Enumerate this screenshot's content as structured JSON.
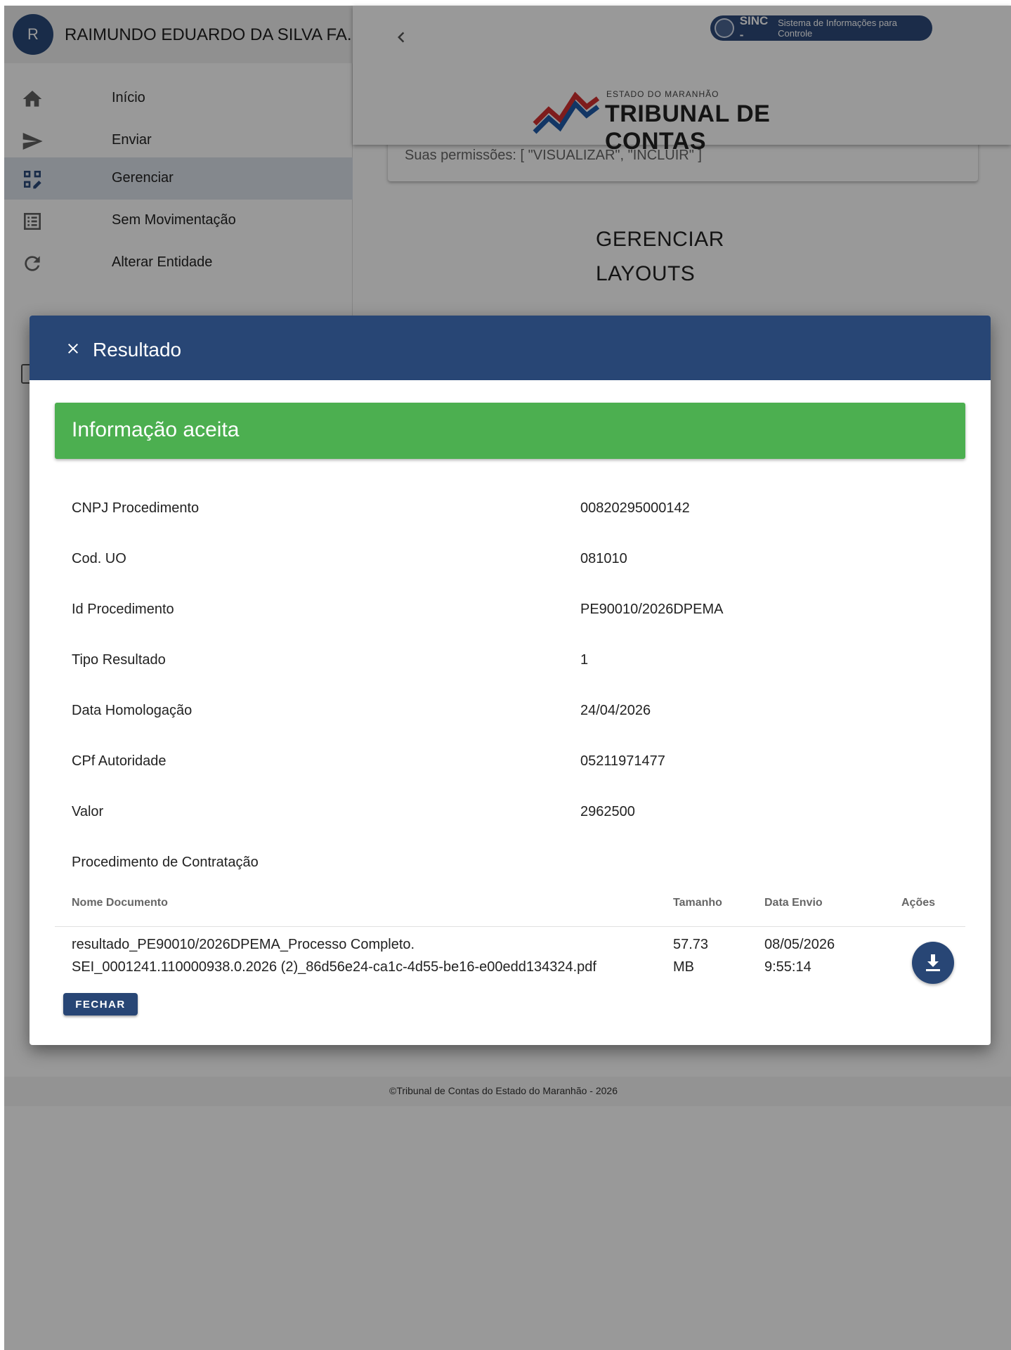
{
  "user": {
    "initial": "R",
    "name": "RAIMUNDO EDUARDO DA SILVA FA..."
  },
  "nav": [
    {
      "label": "Início",
      "icon": "home-icon"
    },
    {
      "label": "Enviar",
      "icon": "send-icon"
    },
    {
      "label": "Gerenciar",
      "icon": "manage-icon",
      "active": true
    },
    {
      "label": "Sem Movimentação",
      "icon": "list-icon"
    },
    {
      "label": "Alterar Entidade",
      "icon": "refresh-icon"
    }
  ],
  "header": {
    "sinc_name": "SINC -",
    "sinc_sub": "Sistema de Informações para Controle",
    "org_small": "ESTADO DO MARANHÃO",
    "org_big": "TRIBUNAL DE CONTAS"
  },
  "main": {
    "permissions": "Suas permissões: [ \"VISUALIZAR\", \"INCLUIR\" ]",
    "title_line1": "GERENCIAR",
    "title_line2": "LAYOUTS"
  },
  "footer": "©Tribunal de Contas do Estado do Maranhão - 2026",
  "dialog": {
    "title": "Resultado",
    "status": "Informação aceita",
    "fields": [
      {
        "label": "CNPJ Procedimento",
        "value": "00820295000142"
      },
      {
        "label": "Cod. UO",
        "value": "081010"
      },
      {
        "label": "Id Procedimento",
        "value": "PE90010/2026DPEMA"
      },
      {
        "label": "Tipo Resultado",
        "value": "1"
      },
      {
        "label": "Data Homologação",
        "value": "24/04/2026"
      },
      {
        "label": "CPf Autoridade",
        "value": "05211971477"
      },
      {
        "label": "Valor",
        "value": "2962500"
      },
      {
        "label": "Procedimento de Contratação",
        "value": ""
      }
    ],
    "table": {
      "headers": {
        "name": "Nome Documento",
        "size": "Tamanho",
        "date": "Data Envio",
        "actions": "Ações"
      },
      "rows": [
        {
          "name_line1": "resultado_PE90010/2026DPEMA_Processo Completo.",
          "name_line2": "SEI_0001241.110000938.0.2026 (2)_86d56e24-ca1c-4d55-be16-e00edd134324.pdf",
          "size_line1": "57.73",
          "size_line2": "MB",
          "date_line1": "08/05/2026",
          "date_line2": "9:55:14"
        }
      ]
    },
    "close_button": "FECHAR"
  },
  "colors": {
    "primary": "#284675",
    "success": "#4caf50"
  }
}
